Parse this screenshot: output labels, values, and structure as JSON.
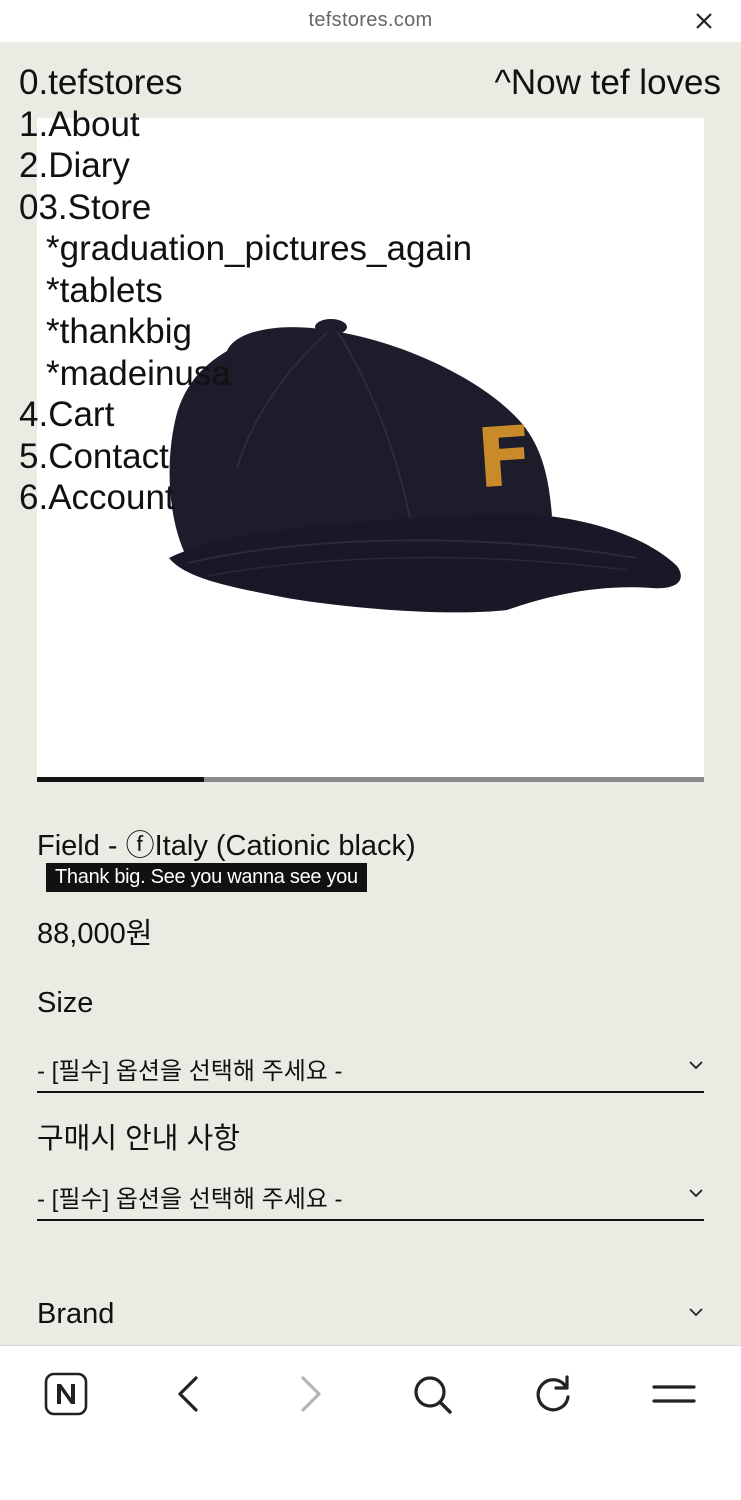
{
  "browser": {
    "url": "tefstores.com",
    "close_icon": "close-icon"
  },
  "nav": {
    "items": [
      "0.tefstores",
      "1.About",
      "2.Diary",
      "03.Store"
    ],
    "store_sub": [
      "*graduation_pictures_again",
      "*tablets",
      "*thankbig",
      "*madeinusa"
    ],
    "items_after": [
      "4.Cart",
      "5.Contact",
      "6.Account"
    ],
    "now_loves": "^Now tef loves"
  },
  "product": {
    "image_icon": "baseball-cap-icon",
    "cap_color": "#1c1c2b",
    "letter_color": "#c98a2a",
    "cap_letter": "F",
    "slider_progress": 0.25,
    "title": "Field - ⓕItaly (Cationic black)",
    "tagline": "Thank big. See you wanna see you",
    "price": "88,000원"
  },
  "options": {
    "size_label": "Size",
    "size_value": "- [필수] 옵션을 선택해 주세요 -",
    "notice_label": "구매시 안내 사항",
    "notice_value": "- [필수] 옵션을 선택해 주세요 -",
    "brand_label": "Brand"
  },
  "toolbar": {
    "icons": [
      "naver-home-icon",
      "back-arrow-icon",
      "forward-arrow-icon",
      "search-icon",
      "reload-icon",
      "menu-icon"
    ]
  }
}
